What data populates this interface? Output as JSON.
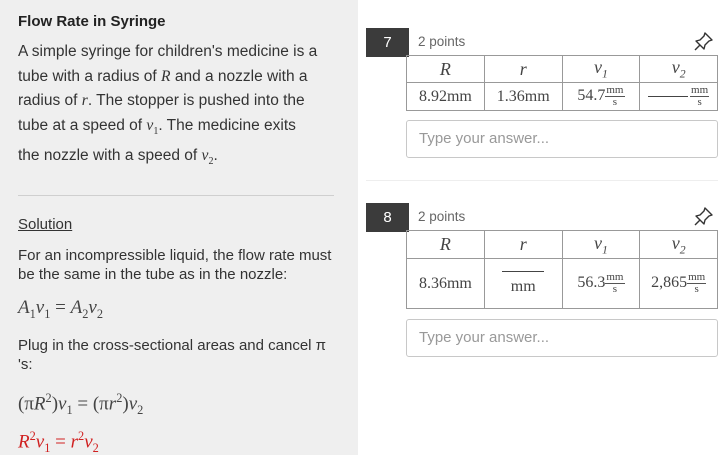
{
  "left": {
    "title": "Flow Rate in Syringe",
    "problem_lines": [
      "A simple syringe for children's medicine is a",
      "tube with a radius of",
      "and a nozzle with a",
      "radius of",
      ". The stopper is pushed into the",
      "tube at a speed of",
      ". The medicine exits",
      "the nozzle with a speed of"
    ],
    "solution_label": "Solution",
    "solution_colon": ":",
    "sol_text_1": "For an incompressible liquid, the flow rate must be the same in the tube as in the nozzle:",
    "sol_text_2": "Plug in the cross-sectional areas and cancel π 's:",
    "colors": {
      "highlight": "#d02020",
      "panel_bg": "#efefef"
    }
  },
  "questions": [
    {
      "number": "7",
      "points": "2 points",
      "headers": [
        "R",
        "r",
        "v1",
        "v2"
      ],
      "values": [
        "8.92mm",
        "1.36mm",
        "54.7",
        ""
      ],
      "unit_v": "mm",
      "unit_den": "s",
      "placeholder": "Type your answer..."
    },
    {
      "number": "8",
      "points": "2 points",
      "headers": [
        "R",
        "r",
        "v1",
        "v2"
      ],
      "values": [
        "8.36mm",
        "",
        "56.3",
        "2,865"
      ],
      "unit_r": "mm",
      "unit_v": "mm",
      "unit_den": "s",
      "placeholder": "Type your answer..."
    }
  ]
}
